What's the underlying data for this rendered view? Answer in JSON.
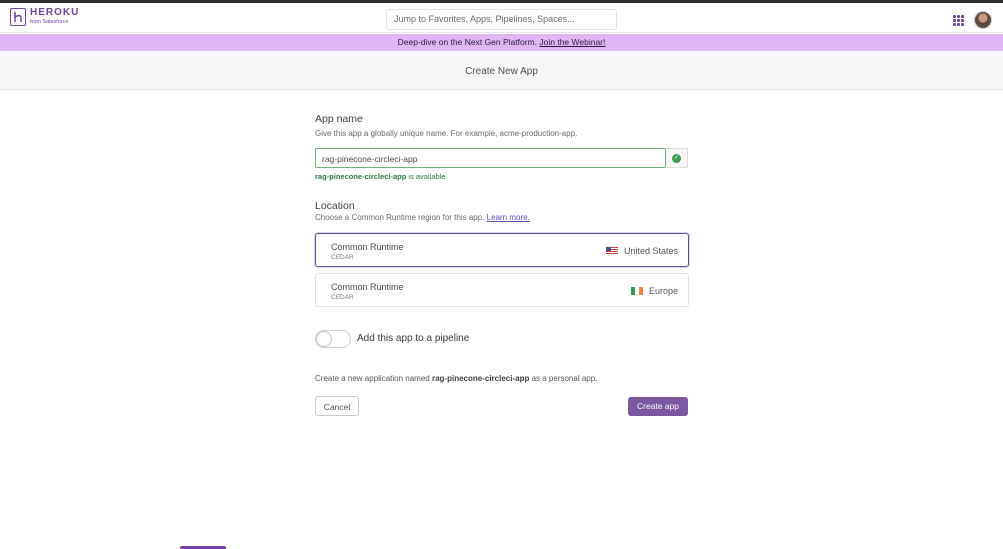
{
  "header": {
    "brand_name": "HEROKU",
    "brand_sub": "from Salesforce",
    "search_placeholder": "Jump to Favorites, Apps, Pipelines, Spaces..."
  },
  "banner": {
    "text": "Deep-dive on the Next Gen Platform.",
    "link": "Join the Webinar!"
  },
  "page": {
    "title": "Create New App"
  },
  "app_name": {
    "label": "App name",
    "description": "Give this app a globally unique name. For example, acme-production-app.",
    "value": "rag-pinecone-circleci-app",
    "availability_name": "rag-pinecone-circleci-app",
    "availability_text": "is available"
  },
  "location": {
    "label": "Location",
    "description": "Choose a Common Runtime region for this app.",
    "learn_more": "Learn more.",
    "regions": [
      {
        "name": "Common Runtime",
        "stack": "CEDAR",
        "region": "United States",
        "selected": true
      },
      {
        "name": "Common Runtime",
        "stack": "CEDAR",
        "region": "Europe",
        "selected": false
      }
    ]
  },
  "pipeline": {
    "label": "Add this app to a pipeline",
    "enabled": false
  },
  "summary": {
    "prefix": "Create a new application named",
    "app": "rag-pinecone-circleci-app",
    "suffix": "as a personal app."
  },
  "actions": {
    "cancel": "Cancel",
    "create": "Create app"
  },
  "colors": {
    "brand": "#6f42a6",
    "banner": "#e0b6f2",
    "primary_button": "#79589f",
    "success": "#3c9b4d"
  }
}
